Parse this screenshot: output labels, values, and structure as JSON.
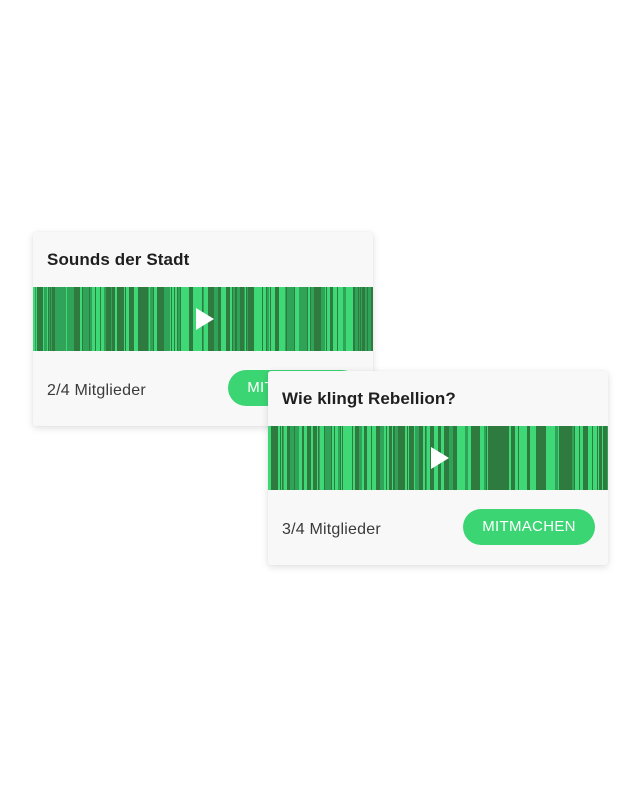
{
  "colors": {
    "accent": "#3cd574",
    "wave_dark": "#2f7a3f",
    "wave_light": "#3fd877",
    "wave_mid": "#2fa358",
    "card_background": "#f8f8f8"
  },
  "cards": [
    {
      "title": "Sounds der Stadt",
      "members": "2/4 Mitglieder",
      "button_label": "MITMACHEN",
      "play_icon": "play-icon"
    },
    {
      "title": "Wie klingt Rebellion?",
      "members": "3/4 Mitglieder",
      "button_label": "MITMACHEN",
      "play_icon": "play-icon"
    }
  ]
}
